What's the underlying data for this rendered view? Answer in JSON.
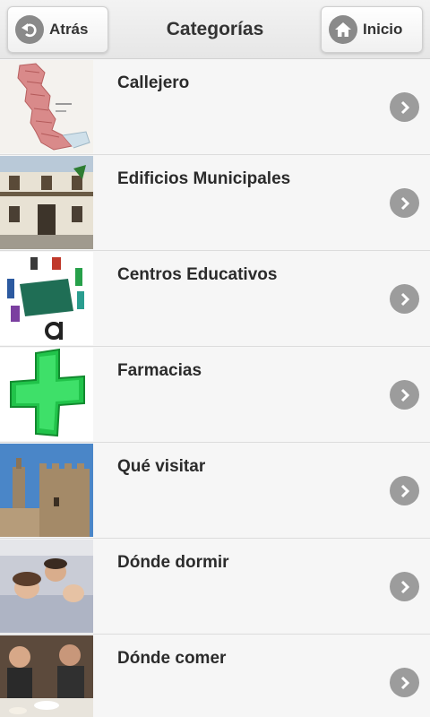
{
  "header": {
    "title": "Categorías",
    "back_label": "Atrás",
    "home_label": "Inicio"
  },
  "categories": [
    {
      "label": "Callejero",
      "icon": "street-map-thumbnail"
    },
    {
      "label": "Edificios Municipales",
      "icon": "town-hall-thumbnail"
    },
    {
      "label": "Centros Educativos",
      "icon": "education-thumbnail"
    },
    {
      "label": "Farmacias",
      "icon": "pharmacy-cross-thumbnail"
    },
    {
      "label": "Qué visitar",
      "icon": "castle-tower-thumbnail"
    },
    {
      "label": "Dónde dormir",
      "icon": "sleeping-family-thumbnail"
    },
    {
      "label": "Dónde comer",
      "icon": "dining-people-thumbnail"
    }
  ],
  "colors": {
    "header_bg": "#e9e9e9",
    "row_bg": "#f6f6f6",
    "chevron_bg": "#9c9c9c",
    "text": "#2b2b2b"
  }
}
